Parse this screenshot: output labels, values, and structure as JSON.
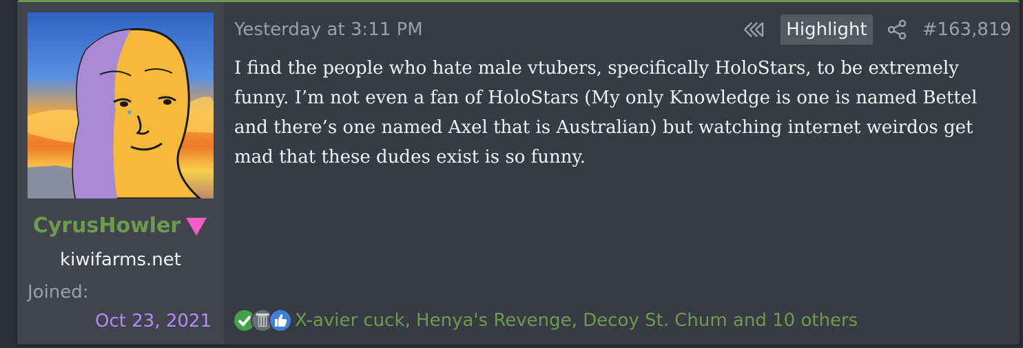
{
  "post": {
    "author": {
      "username": "CyrusHowler",
      "title": "kiwifarms.net",
      "joined_label": "Joined:",
      "joined_date": "Oct 23, 2021",
      "username_color": "#6d9b4e",
      "joined_date_color": "#b48cf2",
      "badge_icon": "pink-triangle-icon"
    },
    "timestamp": "Yesterday at 3:11 PM",
    "actions": {
      "rewind_icon": "rewind-icon",
      "highlight_label": "Highlight",
      "share_icon": "share-icon",
      "post_number": "#163,819"
    },
    "message": "I find the people who hate male vtubers, specifically HoloStars, to be extremely funny. I’m not even a fan of HoloStars (My only Knowledge is one is named Bettel and there’s one named Axel that is Australian) but watching internet weirdos get mad that these dudes exist is so funny.",
    "reactions": {
      "icons": [
        "agree-check-icon",
        "trash-icon",
        "like-thumb-icon"
      ],
      "summary": "X-avier cuck, Henya's Revenge, Decoy St. Chum and 10 others"
    }
  }
}
